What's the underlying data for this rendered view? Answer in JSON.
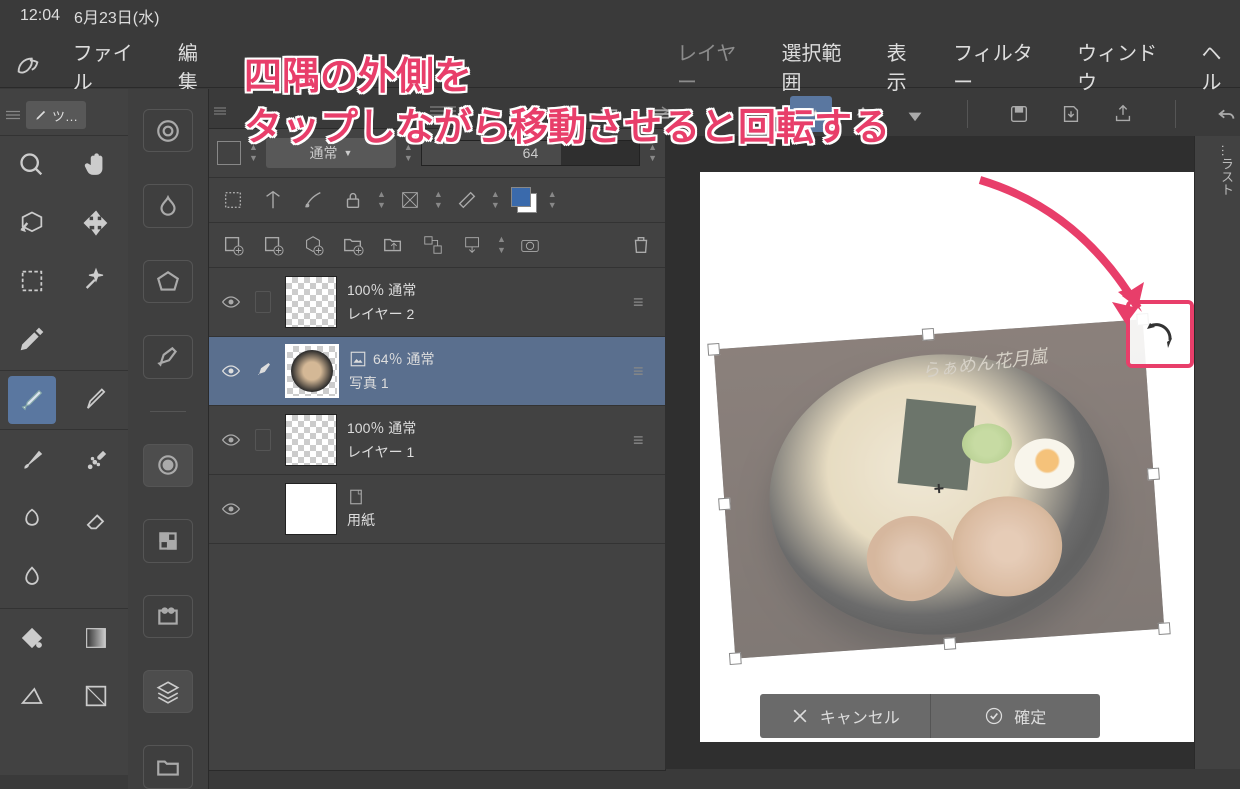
{
  "statusbar": {
    "time": "12:04",
    "date": "6月23日(水)"
  },
  "menubar": {
    "items": [
      "ファイル",
      "編集",
      "",
      "",
      "レイヤー",
      "選択範囲",
      "表示",
      "フィルター",
      "ウィンドウ",
      "ヘル"
    ]
  },
  "overlay": {
    "line1": "四隅の外側を",
    "line2": "タップしながら移動させると回転する"
  },
  "left_tools": {
    "pen_label": "ツ…"
  },
  "layer_panel": {
    "blend_mode": "通常",
    "opacity_value": "64",
    "layers": [
      {
        "opacity": "100％ 通常",
        "name": "レイヤー 2",
        "visible": true,
        "thumbnail": "transparent"
      },
      {
        "opacity": "64％ 通常",
        "name": "写真 1",
        "visible": true,
        "thumbnail": "photo",
        "selected": true,
        "icon": "image-material"
      },
      {
        "opacity": "100％ 通常",
        "name": "レイヤー 1",
        "visible": true,
        "thumbnail": "transparent"
      },
      {
        "opacity": "",
        "name": "用紙",
        "visible": true,
        "thumbnail": "white",
        "icon": "paper"
      }
    ]
  },
  "confirm_bar": {
    "cancel": "キャンセル",
    "ok": "確定"
  },
  "right_col": {
    "label": "…ラスト"
  },
  "photo_writing": "らぁめん花月嵐"
}
